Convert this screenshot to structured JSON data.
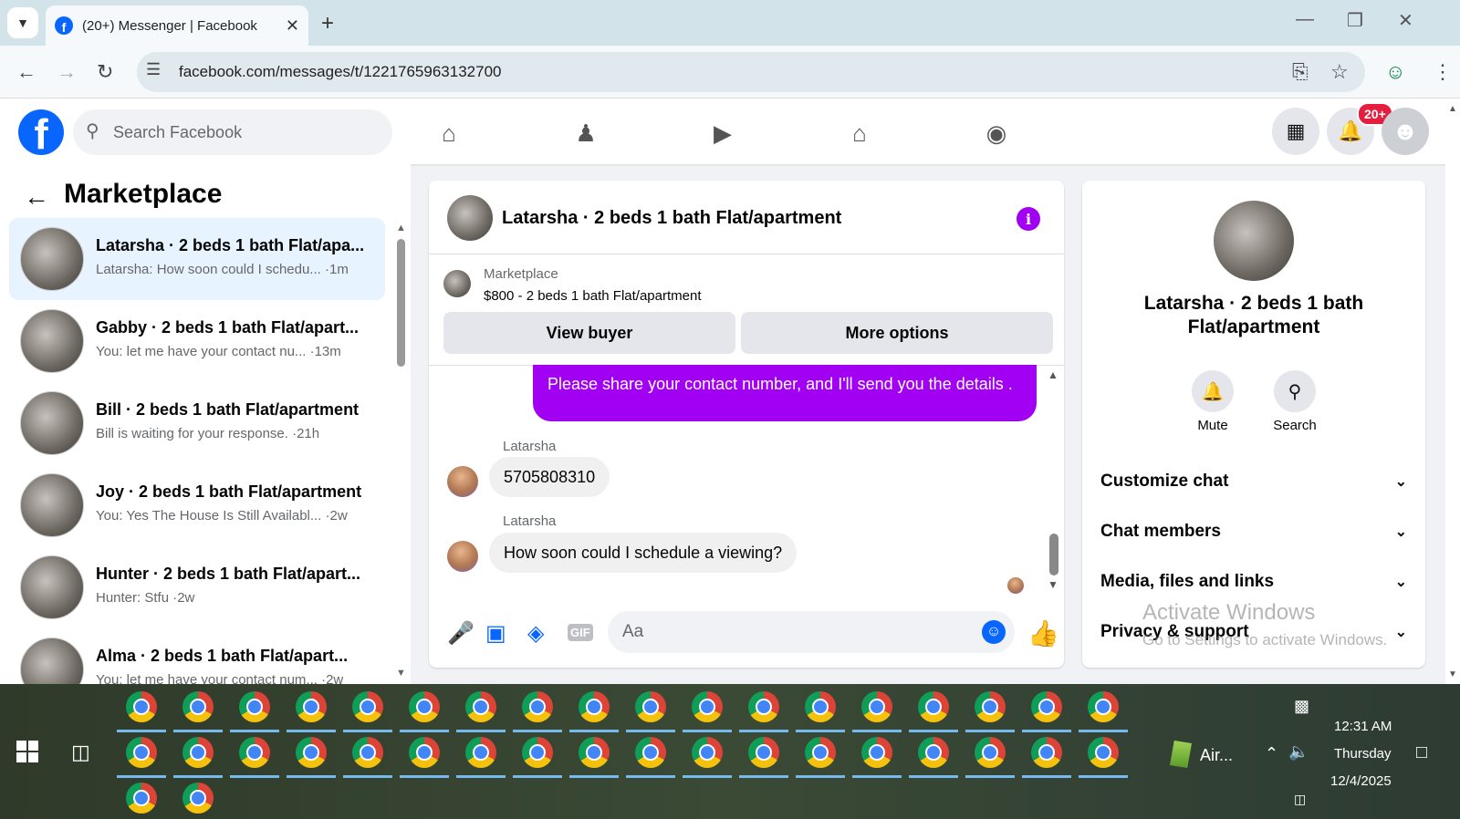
{
  "browser": {
    "tab_title": "(20+) Messenger | Facebook",
    "url": "facebook.com/messages/t/1221765963132700"
  },
  "facebook": {
    "search_placeholder": "Search Facebook",
    "notification_badge": "20+"
  },
  "left_panel": {
    "title": "Marketplace",
    "conversations": [
      {
        "name": "Latarsha · 2 beds 1 bath Flat/apa...",
        "snippet": "Latarsha: How soon could I schedu... ·1m",
        "active": true
      },
      {
        "name": "Gabby · 2 beds 1 bath Flat/apart...",
        "snippet": "You: let me have your contact nu... ·13m"
      },
      {
        "name": "Bill · 2 beds 1 bath Flat/apartment",
        "snippet": "Bill is waiting for your response. ·21h"
      },
      {
        "name": "Joy · 2 beds 1 bath Flat/apartment",
        "snippet": "You: Yes The House Is Still Availabl... ·2w"
      },
      {
        "name": "Hunter · 2 beds 1 bath Flat/apart...",
        "snippet": "Hunter: Stfu ·2w"
      },
      {
        "name": "Alma · 2 beds 1 bath Flat/apart...",
        "snippet": "You: let me have your contact num... ·2w"
      }
    ]
  },
  "chat": {
    "title": "Latarsha · 2 beds 1 bath Flat/apartment",
    "marketplace_label": "Marketplace",
    "listing": "$800 - 2 beds 1 bath Flat/apartment",
    "view_buyer": "View buyer",
    "more_options": "More options",
    "outgoing_message": "Please share your contact number, and I'll send you the details .",
    "messages": [
      {
        "sender": "Latarsha",
        "text": "5705808310"
      },
      {
        "sender": "Latarsha",
        "text": "How soon could I schedule a viewing?"
      }
    ],
    "compose_placeholder": "Aa"
  },
  "right_panel": {
    "name": "Latarsha · 2 beds 1 bath Flat/apartment",
    "mute_label": "Mute",
    "search_label": "Search",
    "sections": [
      "Customize chat",
      "Chat members",
      "Media, files and links",
      "Privacy & support"
    ]
  },
  "watermark": {
    "line1": "Activate Windows",
    "line2": "Go to Settings to activate Windows."
  },
  "taskbar": {
    "pinned_app_label": "Air...",
    "time": "12:31 AM",
    "day": "Thursday",
    "date": "12/4/2025"
  }
}
